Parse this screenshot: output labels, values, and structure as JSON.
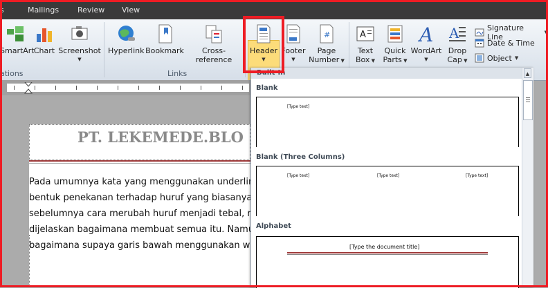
{
  "tabs": [
    "s",
    "Mailings",
    "Review",
    "View"
  ],
  "ribbon": {
    "buttons": {
      "smartart": "SmartArt",
      "chart": "Chart",
      "screenshot": "Screenshot",
      "hyperlink": "Hyperlink",
      "bookmark": "Bookmark",
      "cross_reference": "Cross-reference",
      "header": "Header",
      "footer": "Footer",
      "page_number_l1": "Page",
      "page_number_l2": "Number",
      "text_box_l1": "Text",
      "text_box_l2": "Box",
      "quick_parts_l1": "Quick",
      "quick_parts_l2": "Parts",
      "wordart": "WordArt",
      "drop_cap_l1": "Drop",
      "drop_cap_l2": "Cap",
      "signature_line": "Signature Line",
      "date_time": "Date & Time",
      "object": "Object"
    },
    "groups": {
      "illustrations": "ations",
      "links": "Links"
    }
  },
  "document": {
    "header_title": "PT. LEKEMEDE.BLO",
    "paragraph_lines": [
      "Pada umumnya kata yang menggunakan underlin",
      "bentuk penekanan terhadap huruf yang biasanya",
      "sebelumnya cara merubah huruf menjadi tebal, r",
      "dijelaskan bagaimana membuat semua itu. Namu",
      "bagaimana supaya garis bawah menggunakan wa"
    ]
  },
  "gallery": {
    "category": "Built-In",
    "items": [
      {
        "name": "Blank",
        "placeholders": [
          "[Type text]"
        ]
      },
      {
        "name": "Blank (Three Columns)",
        "placeholders": [
          "[Type text]",
          "[Type text]",
          "[Type text]"
        ]
      },
      {
        "name": "Alphabet",
        "placeholders": [
          "[Type the document title]"
        ]
      }
    ]
  },
  "colors": {
    "highlight_border": "#ee1c24",
    "header_button_fill": "#fcdc7a",
    "alphabet_rule": "#9f3a3a"
  }
}
